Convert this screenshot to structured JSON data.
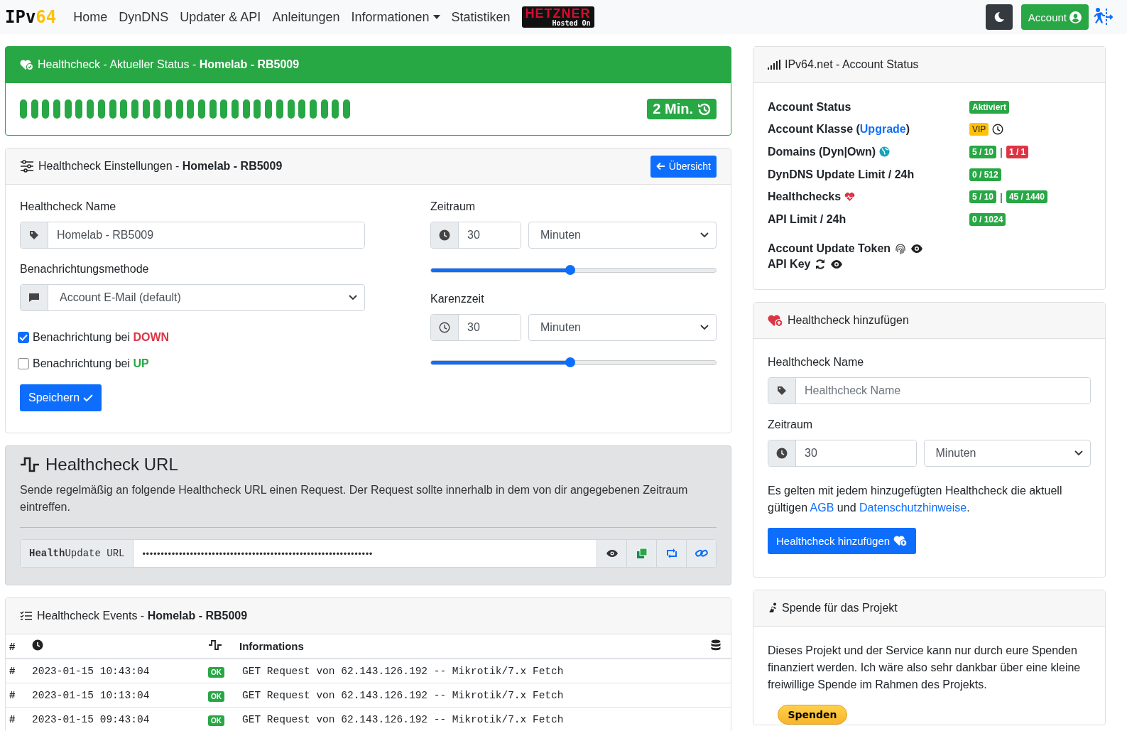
{
  "navbar": {
    "logo_main": "IPv",
    "logo_accent": "64",
    "links": [
      {
        "label": "Home",
        "dropdown": false
      },
      {
        "label": "DynDNS",
        "dropdown": false
      },
      {
        "label": "Updater & API",
        "dropdown": false
      },
      {
        "label": "Anleitungen",
        "dropdown": false
      },
      {
        "label": "Informationen",
        "dropdown": true
      },
      {
        "label": "Statistiken",
        "dropdown": false
      }
    ],
    "sponsor": {
      "name": "HETZNER",
      "tagline": "Hosted On"
    },
    "account_button": "Account"
  },
  "status_card": {
    "title": "Healthcheck - Aktueller Status - ",
    "title_bold": "Homelab - RB5009",
    "beats": [
      {
        "ok": true
      },
      {
        "ok": true
      },
      {
        "ok": true
      },
      {
        "ok": true
      },
      {
        "ok": true
      },
      {
        "ok": true
      },
      {
        "ok": true
      },
      {
        "ok": true
      },
      {
        "ok": true
      },
      {
        "ok": true
      },
      {
        "ok": true
      },
      {
        "ok": true
      },
      {
        "ok": true
      },
      {
        "ok": true
      },
      {
        "ok": true
      },
      {
        "ok": true
      },
      {
        "ok": true
      },
      {
        "ok": true
      },
      {
        "ok": true
      },
      {
        "ok": true
      },
      {
        "ok": true
      },
      {
        "ok": true
      },
      {
        "ok": true
      },
      {
        "ok": true
      },
      {
        "ok": true
      },
      {
        "ok": true
      },
      {
        "ok": true
      },
      {
        "ok": true
      },
      {
        "ok": true
      },
      {
        "ok": true
      }
    ],
    "interval_badge": "2 Min."
  },
  "settings_card": {
    "title": "Healthcheck Einstellungen - ",
    "title_bold": "Homelab - RB5009",
    "overview_button": "Übersicht",
    "name_label": "Healthcheck Name",
    "name_value": "Homelab - RB5009",
    "method_label": "Benachrichtungsmethode",
    "method_value": "Account E-Mail (default)",
    "notifications": [
      {
        "label": "Benachrichtung bei ",
        "state_word": "DOWN",
        "kind": "down",
        "checked": true
      },
      {
        "label": "Benachrichtung bei ",
        "state_word": "UP",
        "kind": "up",
        "checked": false
      }
    ],
    "save_button": "Speichern",
    "timers": [
      {
        "label": "Zeitraum",
        "value": "30",
        "unit": "Minuten",
        "level": 0.49
      },
      {
        "label": "Karenzzeit",
        "value": "30",
        "unit": "Minuten",
        "level": 0.49
      }
    ]
  },
  "url_card": {
    "title": "Healthcheck URL",
    "description": "Sende regelmäßig an folgende Healthcheck URL einen Request. Der Request sollte innerhalb in dem von dir angegebenen Zeitraum eintreffen.",
    "url_label": "**Health**Update URL",
    "url_value": "•••••••••••••••••••••••••••••••••••••••••••••••••••••••••••••••"
  },
  "events_card": {
    "title": "Healthcheck Events - ",
    "title_bold": "Homelab - RB5009",
    "columns": [
      {
        "kind": "text",
        "label": "#"
      },
      {
        "kind": "clock"
      },
      {
        "kind": "pulse"
      },
      {
        "kind": "text",
        "label": "Informations"
      },
      {
        "kind": "database"
      }
    ],
    "rows": [
      {
        "mark": "#",
        "time": "2023-01-15 10:43:04",
        "status": "OK",
        "info": "GET Request von 62.143.126.192 -- Mikrotik/7.x Fetch"
      },
      {
        "mark": "#",
        "time": "2023-01-15 10:13:04",
        "status": "OK",
        "info": "GET Request von 62.143.126.192 -- Mikrotik/7.x Fetch"
      },
      {
        "mark": "#",
        "time": "2023-01-15 09:43:04",
        "status": "OK",
        "info": "GET Request von 62.143.126.192 -- Mikrotik/7.x Fetch"
      }
    ]
  },
  "account_card": {
    "title": "IPv64.net - Account Status",
    "rows": [
      {
        "label": "Account Status",
        "badges": [
          {
            "text": "Aktiviert",
            "color": "#28a745"
          }
        ]
      },
      {
        "label": "Account Klasse (",
        "link": "Upgrade",
        "label_after": ")",
        "badges": [
          {
            "text": "VIP",
            "color": "#ffc107"
          }
        ]
      },
      {
        "label": "Domains (Dyn|Own)",
        "badges": [
          {
            "text": "5 / 10",
            "color": "#28a745"
          },
          {
            "text": "1 / 1",
            "color": "#dc3545"
          }
        ],
        "separator": "|"
      },
      {
        "label": "DynDNS Update Limit / 24h",
        "badges": [
          {
            "text": "0 / 512",
            "color": "#28a745"
          }
        ]
      },
      {
        "label": "Healthchecks",
        "badges": [
          {
            "text": "5 / 10",
            "color": "#28a745"
          },
          {
            "text": "45 / 1440",
            "color": "#28a745"
          }
        ],
        "separator": "|"
      },
      {
        "label": "API Limit / 24h",
        "badges": [
          {
            "text": "0 / 1024",
            "color": "#28a745"
          }
        ]
      }
    ],
    "secrets": [
      {
        "label": "Account Update Token"
      },
      {
        "label": "API Key"
      }
    ]
  },
  "add_card": {
    "title": "Healthcheck hinzufügen",
    "name_label": "Healthcheck Name",
    "name_placeholder": "Healthcheck Name",
    "period_label": "Zeitraum",
    "period_value": "30",
    "period_unit": "Minuten",
    "terms_before": "Es gelten mit jedem hinzugefügten Healthcheck die aktuell gültigen ",
    "terms_link1": "AGB",
    "terms_middle": " und ",
    "terms_link2": "Datenschutzhinweise",
    "terms_after": ".",
    "submit_button": "Healthcheck hinzufügen"
  },
  "donate_card": {
    "title": "Spende für das Projekt",
    "text": "Dieses Projekt und der Service kann nur durch eure Spenden finanziert werden. Ich wäre also sehr dankbar über eine kleine freiwillige Spende im Rahmen des Projekts.",
    "button": "Spenden"
  }
}
